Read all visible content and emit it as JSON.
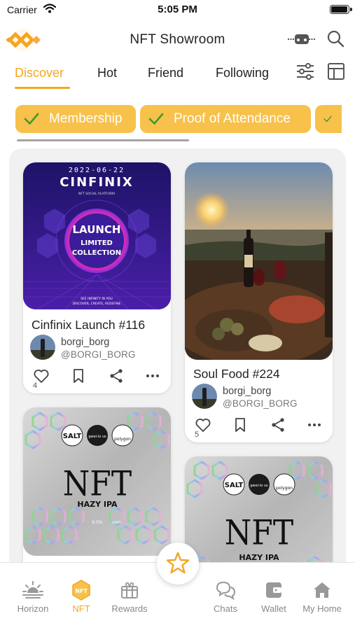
{
  "status_bar": {
    "carrier": "Carrier",
    "time": "5:05 PM"
  },
  "header": {
    "title": "NFT Showroom"
  },
  "tabs": [
    {
      "label": "Discover",
      "active": true
    },
    {
      "label": "Hot",
      "active": false
    },
    {
      "label": "Friend",
      "active": false
    },
    {
      "label": "Following",
      "active": false
    }
  ],
  "chips": [
    {
      "label": "Membership"
    },
    {
      "label": "Proof of Attendance"
    }
  ],
  "cards": [
    {
      "title": "Cinfinix Launch #116",
      "owner_name": "borgi_borg",
      "owner_handle": "@BORGI_BORG",
      "likes": "4",
      "art": {
        "date": "2022-06-22",
        "brand": "CINFINIX",
        "tagline": "NFT SOCIAL PLATFORM",
        "line1": "LAUNCH",
        "line2": "LIMITED",
        "line3": "COLLECTION",
        "footer1": "SEE INFINITY IN YOU",
        "footer2": "DISCOVER, CREATE, REDEFINE"
      }
    },
    {
      "title": "Soul Food #224",
      "owner_name": "borgi_borg",
      "owner_handle": "@BORGI_BORG",
      "likes": "5"
    },
    {
      "art": {
        "badge1": "SALT",
        "badge2": "gwei-lo us",
        "badge3": "polygon",
        "big": "NFT",
        "style": "HAZY IPA",
        "abv": "6.5%",
        "hoppy": "HOPPY"
      }
    },
    {
      "art": {
        "badge1": "SALT",
        "badge2": "gwei-lo us",
        "badge3": "polygon",
        "big": "NFT",
        "style": "HAZY IPA"
      }
    }
  ],
  "nav": {
    "items": [
      {
        "label": "Horizon",
        "icon": "sunrise-icon"
      },
      {
        "label": "NFT",
        "icon": "nft-hexagon-icon",
        "active": true
      },
      {
        "label": "Rewards",
        "icon": "gift-icon"
      },
      {
        "label": "Chats",
        "icon": "chat-bubbles-icon"
      },
      {
        "label": "Wallet",
        "icon": "wallet-icon"
      },
      {
        "label": "My Home",
        "icon": "home-icon"
      }
    ],
    "center_icon": "star-icon"
  },
  "colors": {
    "accent": "#f3a623",
    "chip_bg": "#f7c14b",
    "check": "#3d9a2c",
    "feed_bg": "#f1f1f1"
  }
}
